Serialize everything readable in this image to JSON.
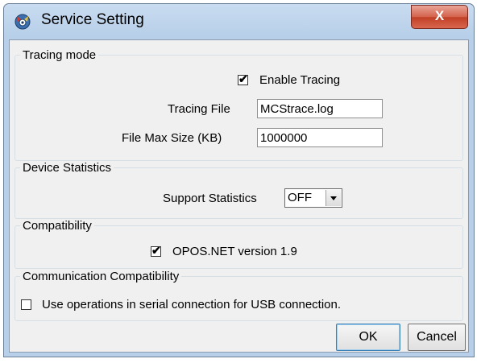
{
  "window": {
    "title": "Service Setting",
    "close_symbol": "X"
  },
  "tracing": {
    "legend": "Tracing mode",
    "enable_label": "Enable Tracing",
    "enable_checked": true,
    "file_label": "Tracing File",
    "file_value": "MCStrace.log",
    "maxsize_label": "File Max Size (KB)",
    "maxsize_value": "1000000"
  },
  "statistics": {
    "legend": "Device Statistics",
    "support_label": "Support Statistics",
    "support_value": "OFF"
  },
  "compatibility": {
    "legend": "Compatibility",
    "opos_label": "OPOS.NET version 1.9",
    "opos_checked": true
  },
  "communication": {
    "legend": "Communication Compatibility",
    "serial_label": "Use operations in serial connection for USB connection.",
    "serial_checked": false
  },
  "buttons": {
    "ok": "OK",
    "cancel": "Cancel"
  },
  "colors": {
    "titlebar": "#b7cfe9",
    "close_button": "#c94a30",
    "dialog_face": "#f0f0f0"
  }
}
